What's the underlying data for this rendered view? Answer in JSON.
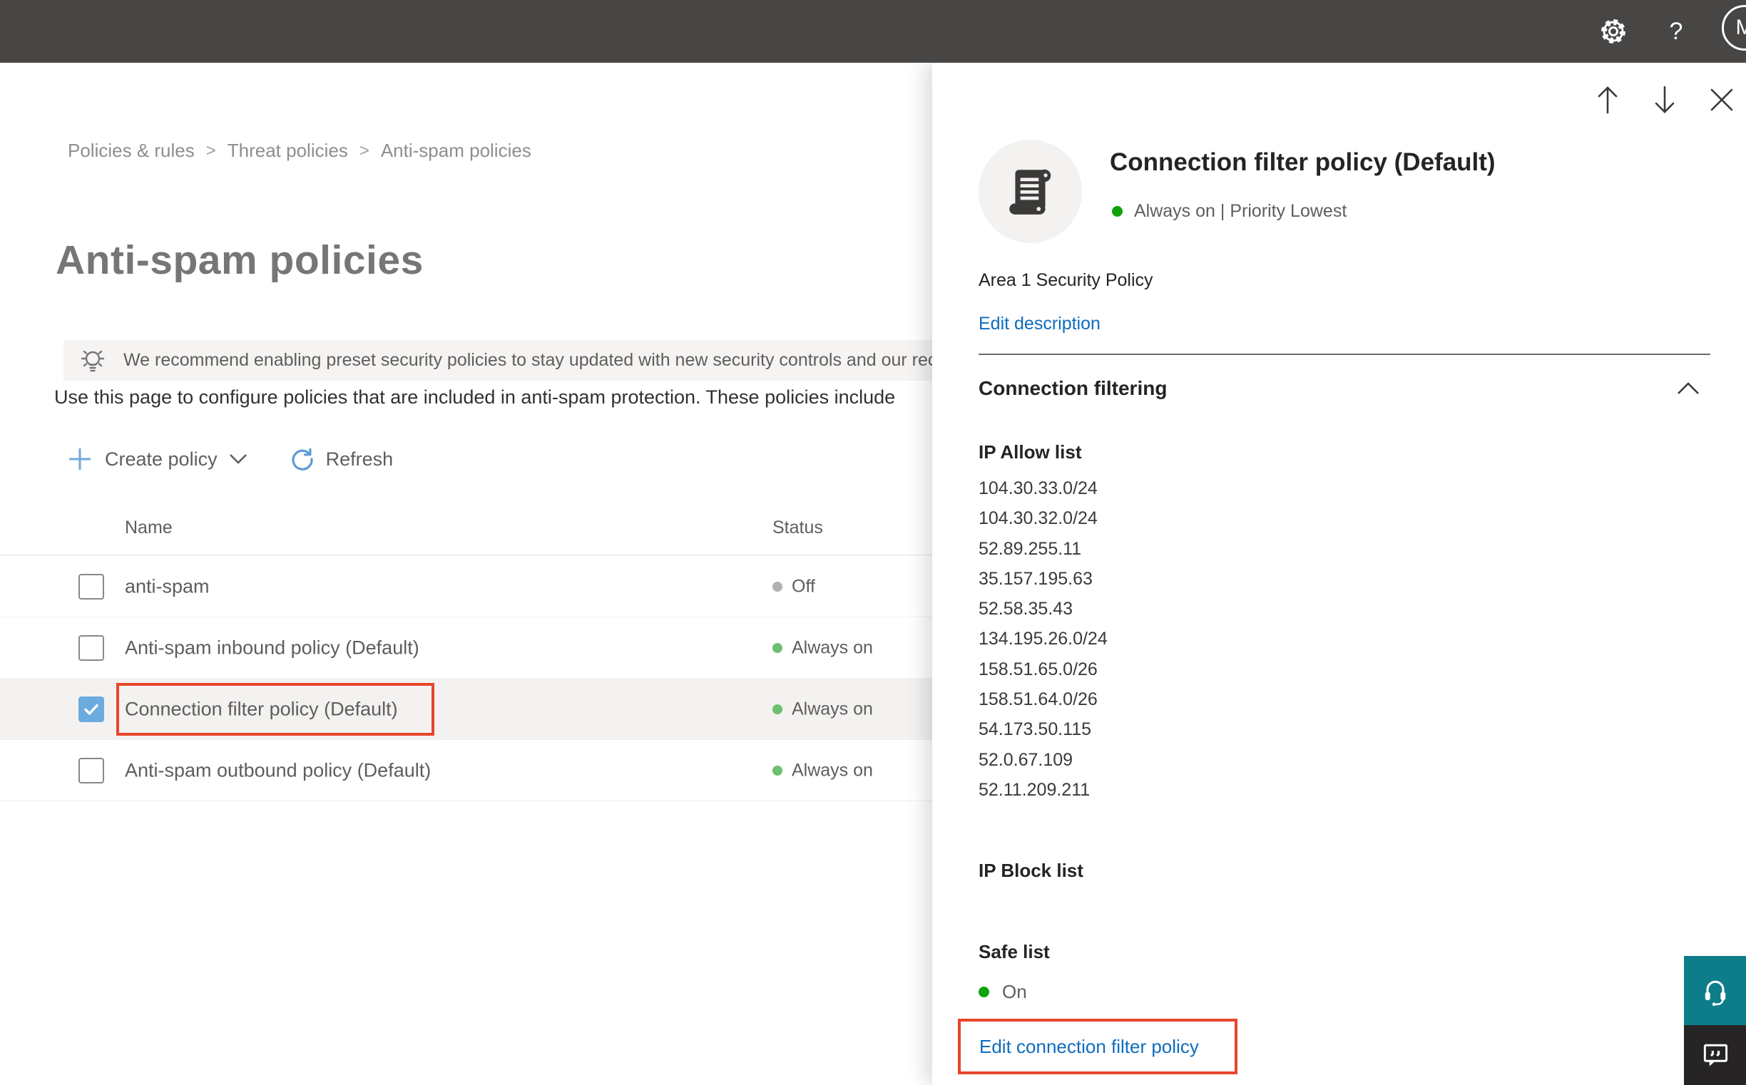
{
  "header": {
    "avatar_initial": "M",
    "help_label": "?"
  },
  "breadcrumb": {
    "items": [
      "Policies & rules",
      "Threat policies",
      "Anti-spam policies"
    ],
    "separator": ">"
  },
  "main": {
    "title": "Anti-spam policies",
    "banner_text": "We recommend enabling preset security policies to stay updated with new security controls and our recomme",
    "intro_text": "Use this page to configure policies that are included in anti-spam protection. These policies include",
    "toolbar": {
      "create_label": "Create policy",
      "refresh_label": "Refresh"
    },
    "table": {
      "columns": {
        "name": "Name",
        "status": "Status"
      },
      "rows": [
        {
          "name": "anti-spam",
          "status": "Off",
          "status_color": "gray",
          "checked": false,
          "selected": false,
          "annotated": false
        },
        {
          "name": "Anti-spam inbound policy (Default)",
          "status": "Always on",
          "status_color": "green",
          "checked": false,
          "selected": false,
          "annotated": false
        },
        {
          "name": "Connection filter policy (Default)",
          "status": "Always on",
          "status_color": "green",
          "checked": true,
          "selected": true,
          "annotated": true
        },
        {
          "name": "Anti-spam outbound policy (Default)",
          "status": "Always on",
          "status_color": "green",
          "checked": false,
          "selected": false,
          "annotated": false
        }
      ]
    }
  },
  "panel": {
    "title": "Connection filter policy (Default)",
    "status_line": "Always on | Priority Lowest",
    "description": "Area 1 Security Policy",
    "edit_description_label": "Edit description",
    "section_title": "Connection filtering",
    "ip_allow": {
      "title": "IP Allow list",
      "entries": [
        "104.30.33.0/24",
        "104.30.32.0/24",
        "52.89.255.11",
        "35.157.195.63",
        "52.58.35.43",
        "134.195.26.0/24",
        "158.51.65.0/26",
        "158.51.64.0/26",
        "54.173.50.115",
        "52.0.67.109",
        "52.11.209.211"
      ]
    },
    "ip_block": {
      "title": "IP Block list"
    },
    "safe_list": {
      "title": "Safe list",
      "status": "On"
    },
    "edit_link_label": "Edit connection filter policy"
  },
  "colors": {
    "header_bar": "#484644",
    "link_blue": "#0F6CBD",
    "annotation_red": "#E8452C",
    "status_green_bright": "#0FA30B",
    "status_green_soft": "#6CC070",
    "status_gray": "#B3B1AF",
    "support_teal": "#0E7D8A",
    "feedback_dark": "#262425",
    "selected_row_bg": "#F3F2F1"
  }
}
